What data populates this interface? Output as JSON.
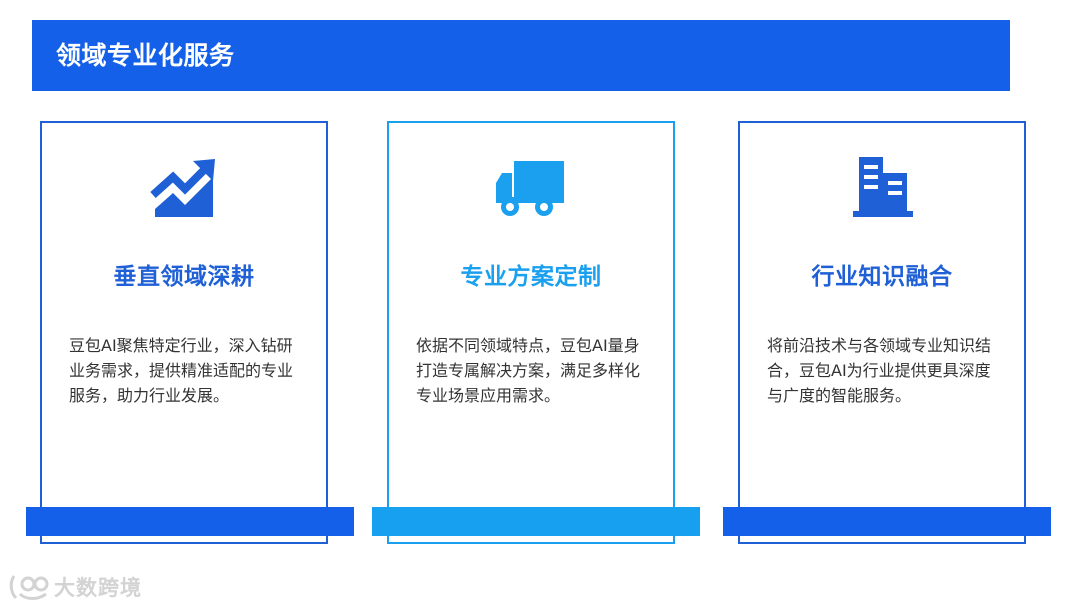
{
  "header": {
    "title": "领域专业化服务"
  },
  "cards": [
    {
      "icon": "growth-chart-icon",
      "title": "垂直领域深耕",
      "description": "豆包AI聚焦特定行业，深入钻研业务需求，提供精准适配的专业服务，助力行业发展。"
    },
    {
      "icon": "delivery-truck-icon",
      "title": "专业方案定制",
      "description": "依据不同领域特点，豆包AI量身打造专属解决方案，满足多样化专业场景应用需求。"
    },
    {
      "icon": "office-building-icon",
      "title": "行业知识融合",
      "description": "将前沿技术与各领域专业知识结合，豆包AI为行业提供更具深度与广度的智能服务。"
    }
  ],
  "watermark": {
    "text": "大数跨境"
  },
  "colors": {
    "primary": "#1560e8",
    "accent": "#1aa0ef",
    "text": "#333333"
  }
}
